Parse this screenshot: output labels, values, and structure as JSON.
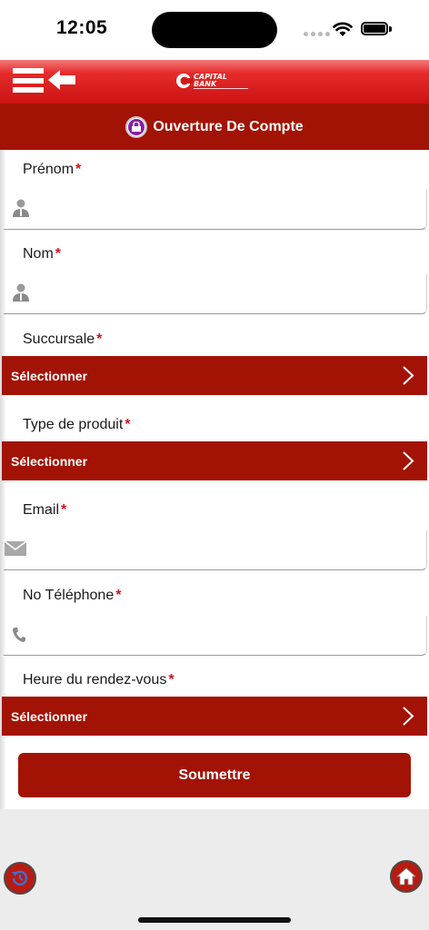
{
  "status_bar": {
    "time": "12:05"
  },
  "header": {
    "logo_text": "CAPITAL BANK",
    "logo_tagline": "ثقة أينما كنت"
  },
  "page": {
    "title": "Ouverture De Compte"
  },
  "form": {
    "required_mark": "*",
    "prenom": {
      "label": "Prénom"
    },
    "nom": {
      "label": "Nom"
    },
    "succursale": {
      "label": "Succursale",
      "value": "Sélectionner"
    },
    "type_produit": {
      "label": "Type de produit",
      "value": "Sélectionner"
    },
    "email": {
      "label": "Email"
    },
    "telephone": {
      "label": "No Téléphone"
    },
    "heure": {
      "label": "Heure du rendez-vous",
      "value": "Sélectionner"
    },
    "submit_label": "Soumettre"
  },
  "colors": {
    "primary": "#a31305",
    "header_red": "#e52b2b",
    "required": "#d0141b"
  },
  "icons": [
    "menu-icon",
    "back-arrow-icon",
    "user-icon",
    "chevron-right-icon",
    "envelope-icon",
    "phone-icon",
    "history-icon",
    "home-icon"
  ]
}
